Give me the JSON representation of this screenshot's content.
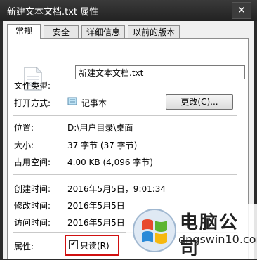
{
  "window": {
    "title": "新建文本文档.txt 属性",
    "close": "✕"
  },
  "tabs": [
    "常规",
    "安全",
    "详细信息",
    "以前的版本"
  ],
  "file": {
    "name": "新建文本文档.txt"
  },
  "labels": {
    "type": "文件类型:",
    "opens_with": "打开方式:",
    "location": "位置:",
    "size": "大小:",
    "size_on_disk": "占用空间:",
    "created": "创建时间:",
    "modified": "修改时间:",
    "accessed": "访问时间:",
    "attributes": "属性:"
  },
  "values": {
    "opens_with_app": "记事本",
    "change_button": "更改(C)...",
    "location": "D:\\用户目录\\桌面",
    "size": "37 字节 (37 字节)",
    "size_on_disk": "4.00 KB (4,096 字节)",
    "created": "2016年5月5日，9:01:34",
    "modified": "2016年5月5日",
    "accessed": "2016年5月5日"
  },
  "attributes": {
    "readonly_label": "只读(R)",
    "readonly_checked": true,
    "check": "✔"
  },
  "brand": {
    "name": "电脑公司",
    "url": "dngswin10.com"
  },
  "colors": {
    "highlight": "#d01010"
  }
}
